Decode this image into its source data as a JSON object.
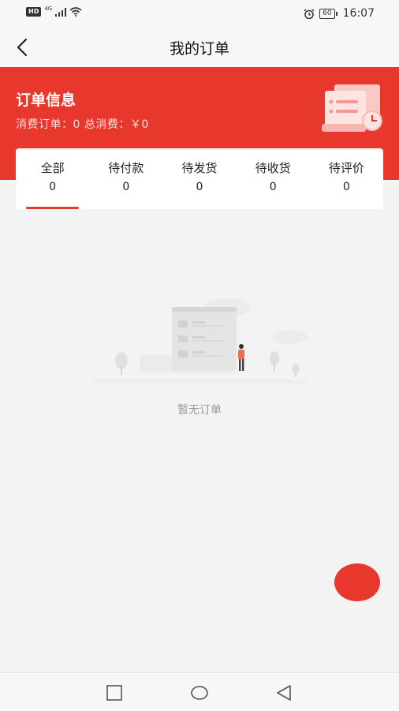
{
  "status_bar": {
    "hd": "HD",
    "network": "4G",
    "battery": "60",
    "time": "16:07"
  },
  "nav": {
    "title": "我的订单"
  },
  "header": {
    "title": "订单信息",
    "subtitle": "消费订单：0 总消费：￥0"
  },
  "tabs": [
    {
      "label": "全部",
      "count": "0",
      "active": true
    },
    {
      "label": "待付款",
      "count": "0"
    },
    {
      "label": "待发货",
      "count": "0"
    },
    {
      "label": "待收货",
      "count": "0"
    },
    {
      "label": "待评价",
      "count": "0"
    }
  ],
  "empty": {
    "text": "暂无订单"
  },
  "colors": {
    "accent": "#e8372c",
    "background": "#f3f3f3"
  },
  "icons": {
    "back": "chevron-left-icon",
    "square": "recent-apps-icon",
    "circle": "home-icon",
    "triangle": "back-triangle-icon"
  }
}
